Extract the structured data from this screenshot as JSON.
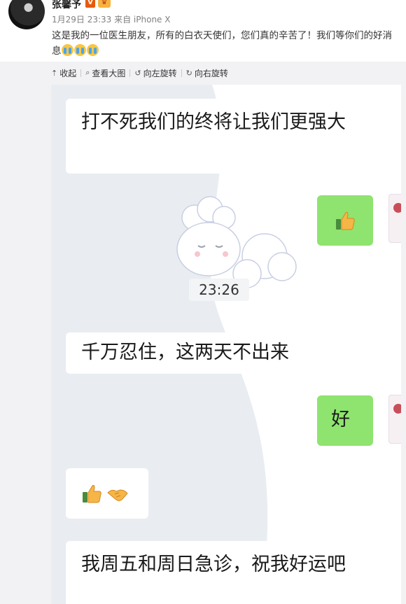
{
  "post": {
    "username": "张馨予",
    "verify_badge": "V",
    "vip_badge": "♛",
    "meta": "1月29日 23:33 来自 iPhone X",
    "text": "这是我的一位医生朋友，所有的白衣天使们，您们真的辛苦了！我们等你们的好消息"
  },
  "toolbar": {
    "collapse": "收起",
    "view_large": "查看大图",
    "rotate_left": "向左旋转",
    "rotate_right": "向右旋转"
  },
  "chat": {
    "msg1": "打不死我们的终将让我们更强大",
    "msg3": "千万忍住，这两天不出来",
    "msg4": "好",
    "msg6": "我周五和周日急诊，祝我好运吧",
    "timestamp": "23:26"
  },
  "colors": {
    "bubble_green": "#8fe36f",
    "panel_gray": "#f2f2f5"
  }
}
